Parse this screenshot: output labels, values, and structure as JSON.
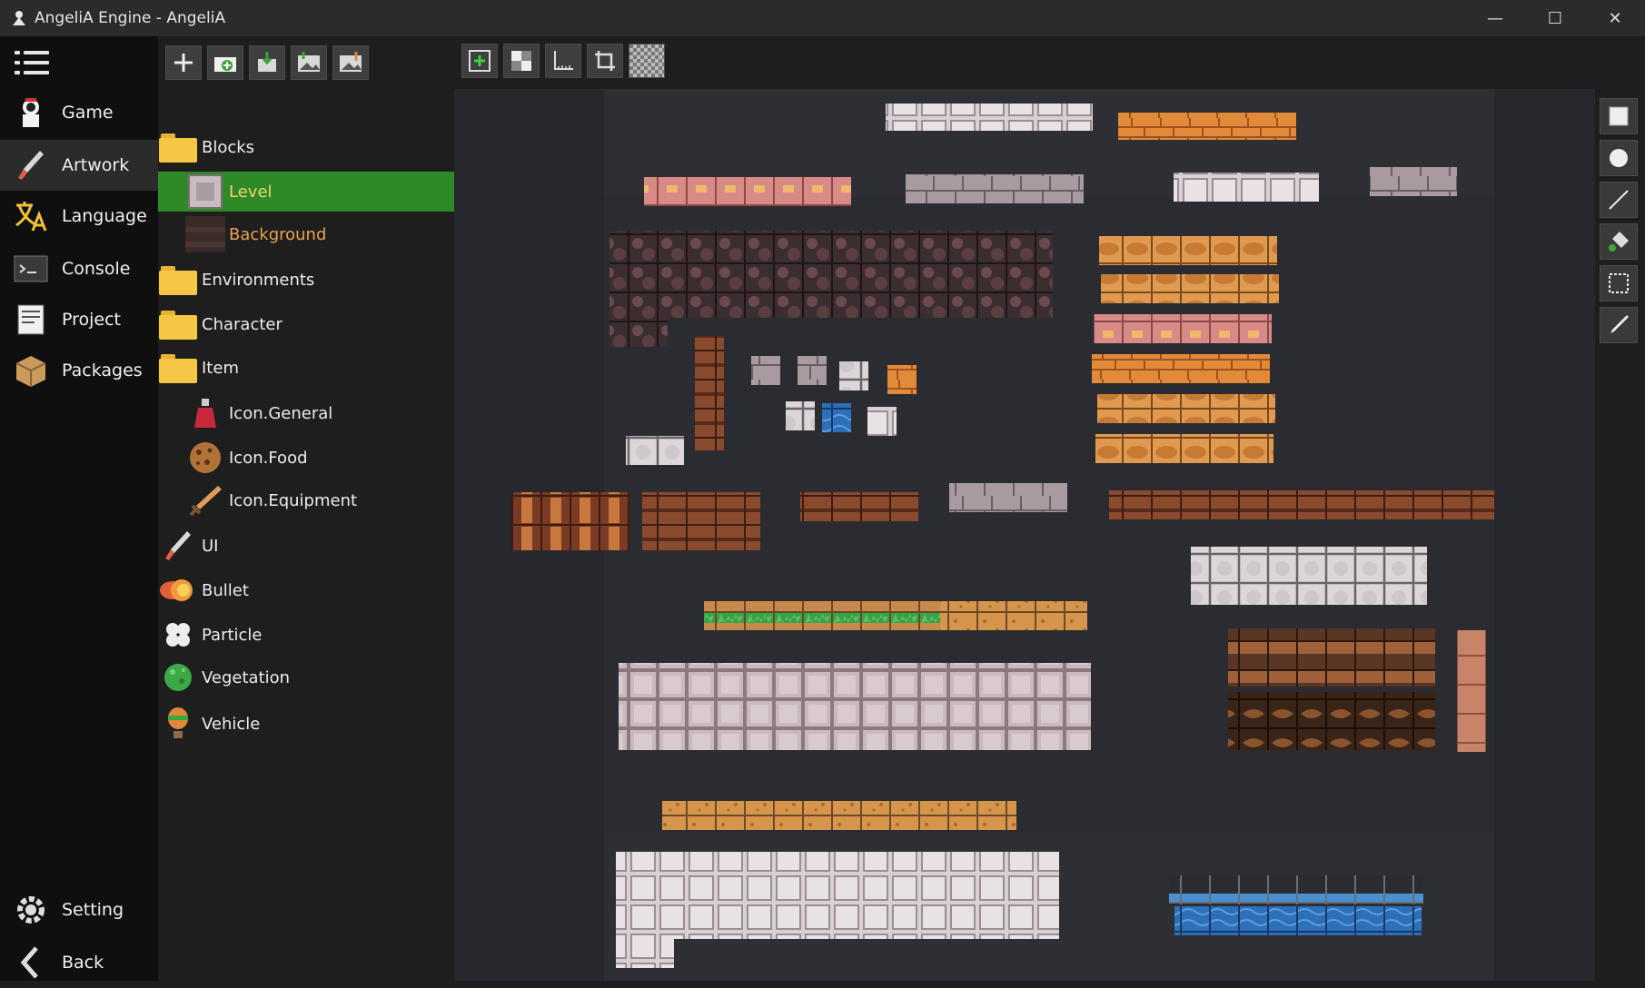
{
  "window": {
    "title": "AngeliA Engine - AngeliA",
    "controls": {
      "minimize": "—",
      "maximize": "☐",
      "close": "✕"
    }
  },
  "nav": {
    "items": [
      {
        "label": "Game",
        "icon": "game-icon"
      },
      {
        "label": "Artwork",
        "icon": "brush-icon",
        "active": true
      },
      {
        "label": "Language",
        "icon": "language-icon"
      },
      {
        "label": "Console",
        "icon": "console-icon"
      },
      {
        "label": "Project",
        "icon": "project-icon"
      },
      {
        "label": "Packages",
        "icon": "package-icon"
      }
    ],
    "bottom": [
      {
        "label": "Setting",
        "icon": "gear-icon"
      },
      {
        "label": "Back",
        "icon": "back-arrow-icon"
      }
    ]
  },
  "tree": {
    "toolbar": [
      "add-icon",
      "add-folder-icon",
      "import-icon",
      "import-image-icon",
      "export-image-icon"
    ],
    "items": [
      {
        "label": "Blocks",
        "type": "folder"
      },
      {
        "label": "Level",
        "type": "sheet",
        "selected": true
      },
      {
        "label": "Background",
        "type": "sheet"
      },
      {
        "label": "Environments",
        "type": "folder"
      },
      {
        "label": "Character",
        "type": "folder"
      },
      {
        "label": "Item",
        "type": "folder"
      },
      {
        "label": "Icon.General",
        "type": "sheet"
      },
      {
        "label": "Icon.Food",
        "type": "sheet"
      },
      {
        "label": "Icon.Equipment",
        "type": "sheet"
      },
      {
        "label": "UI",
        "type": "sheet"
      },
      {
        "label": "Bullet",
        "type": "sheet"
      },
      {
        "label": "Particle",
        "type": "sheet"
      },
      {
        "label": "Vegetation",
        "type": "sheet"
      },
      {
        "label": "Vehicle",
        "type": "sheet"
      }
    ]
  },
  "canvas_toolbar": [
    "add-sprite-icon",
    "checker-icon",
    "ruler-icon",
    "crop-icon",
    "transparency-icon"
  ],
  "tools": [
    "rectangle-icon",
    "circle-icon",
    "line-icon",
    "bucket-icon",
    "selection-icon",
    "pen-icon"
  ],
  "colors": {
    "selected_bg": "#2e8a26",
    "selected_text": "#f2d36b",
    "folder": "#f6c744",
    "canvas_bg": "#26282d",
    "sheet_bg": "#2d2f34"
  }
}
